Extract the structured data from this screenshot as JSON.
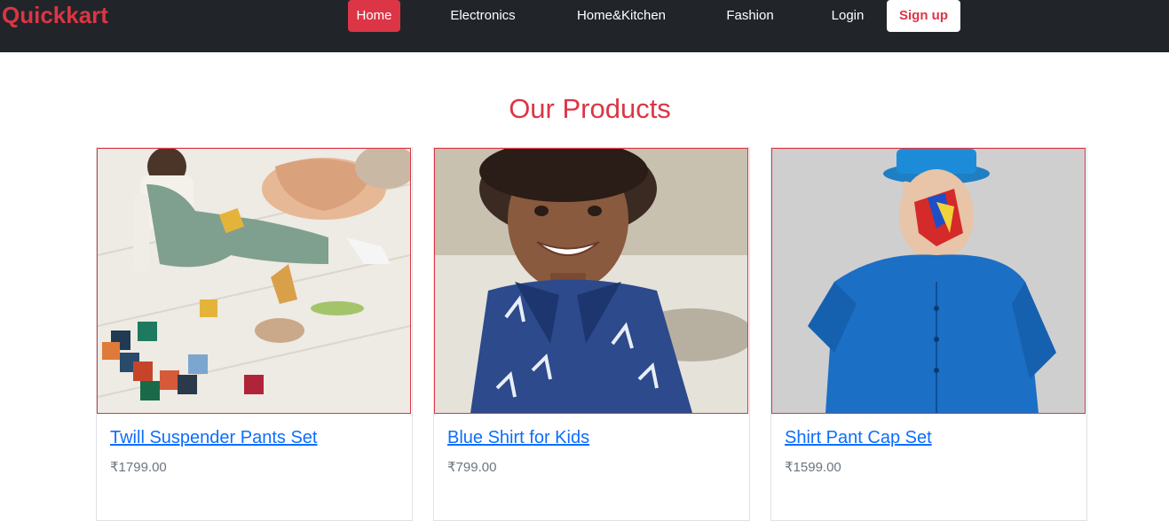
{
  "navbar": {
    "brand": "Quickkart",
    "links": [
      "Home",
      "Electronics",
      "Home&Kitchen",
      "Fashion",
      "Login"
    ],
    "signup": "Sign up",
    "active_color": "#dc3545",
    "background_color": "#212529"
  },
  "main": {
    "title": "Our Products",
    "products": [
      {
        "title": "Twill Suspender Pants Set",
        "price": "₹1799.00"
      },
      {
        "title": "Blue Shirt for Kids",
        "price": "₹799.00"
      },
      {
        "title": "Shirt Pant Cap Set",
        "price": "₹1599.00"
      }
    ]
  },
  "colors": {
    "brand": "#dc3545",
    "link": "#0d6efd",
    "price": "#6c757d"
  }
}
